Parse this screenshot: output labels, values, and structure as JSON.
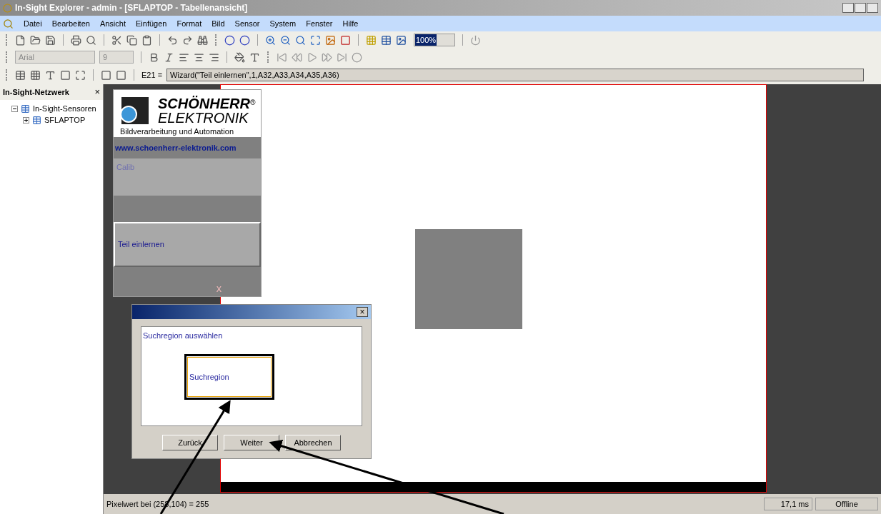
{
  "window": {
    "title": "In-Sight Explorer - admin - [SFLAPTOP - Tabellenansicht]"
  },
  "menu": [
    "Datei",
    "Bearbeiten",
    "Ansicht",
    "Einfügen",
    "Format",
    "Bild",
    "Sensor",
    "System",
    "Fenster",
    "Hilfe"
  ],
  "toolbar": {
    "zoom": "100%",
    "font": "Arial",
    "font_size": "9"
  },
  "formula_bar": {
    "cell": "E21 =",
    "formula": "Wizard(\"Teil einlernen\",1,A32,A33,A34,A35,A36)"
  },
  "network_panel": {
    "title": "In-Sight-Netzwerk",
    "close": "×",
    "tree": [
      {
        "label": "In-Sight-Sensoren",
        "expanded": true,
        "children": [
          {
            "label": "SFLAPTOP",
            "expanded": false
          }
        ]
      }
    ]
  },
  "sheet": {
    "logo_brand": "SCHÖNHERR",
    "logo_registered": "®",
    "logo_line2": "ELEKTRONIK",
    "logo_tagline": "Bildverarbeitung und Automation",
    "url": "www.schoenherr-elektronik.com",
    "calib_button": "Calib",
    "learn_button": "Teil einlernen",
    "marker": "X"
  },
  "dialog": {
    "prompt": "Suchregion auswählen",
    "region_button": "Suchregion",
    "buttons": [
      "Zurück",
      "Weiter",
      "Abbrechen"
    ],
    "close": "×"
  },
  "status_bar": {
    "pixel": "Pixelwert bei (258,104) = 255",
    "time": "17,1 ms",
    "state": "Offline"
  }
}
